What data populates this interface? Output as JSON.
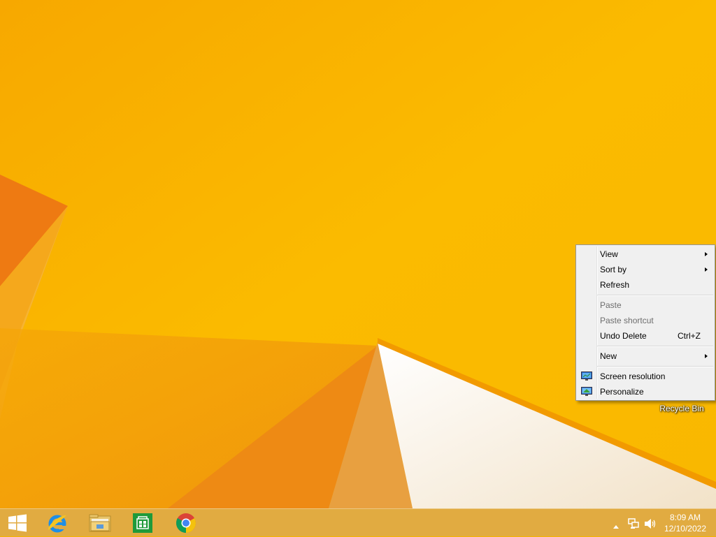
{
  "desktop": {
    "recycle_bin_label": "Recycle Bin"
  },
  "context_menu": {
    "items": [
      {
        "label": "View",
        "submenu": true
      },
      {
        "label": "Sort by",
        "submenu": true
      },
      {
        "label": "Refresh"
      },
      {
        "label": "Paste",
        "disabled": true
      },
      {
        "label": "Paste shortcut",
        "disabled": true
      },
      {
        "label": "Undo Delete",
        "shortcut": "Ctrl+Z"
      },
      {
        "label": "New",
        "submenu": true
      },
      {
        "label": "Screen resolution",
        "icon": "screen-resolution-icon"
      },
      {
        "label": "Personalize",
        "icon": "personalize-icon"
      }
    ]
  },
  "taskbar": {
    "apps": [
      {
        "name": "start",
        "icon": "windows-logo-icon"
      },
      {
        "name": "internet-explorer",
        "icon": "internet-explorer-icon"
      },
      {
        "name": "file-explorer",
        "icon": "folder-icon"
      },
      {
        "name": "store",
        "icon": "store-icon"
      },
      {
        "name": "chrome",
        "icon": "chrome-icon"
      }
    ],
    "clock": {
      "time": "8:09 AM",
      "date": "12/10/2022"
    }
  },
  "colors": {
    "wallpaper": "#f6b400",
    "taskbar": "#deaa46"
  }
}
